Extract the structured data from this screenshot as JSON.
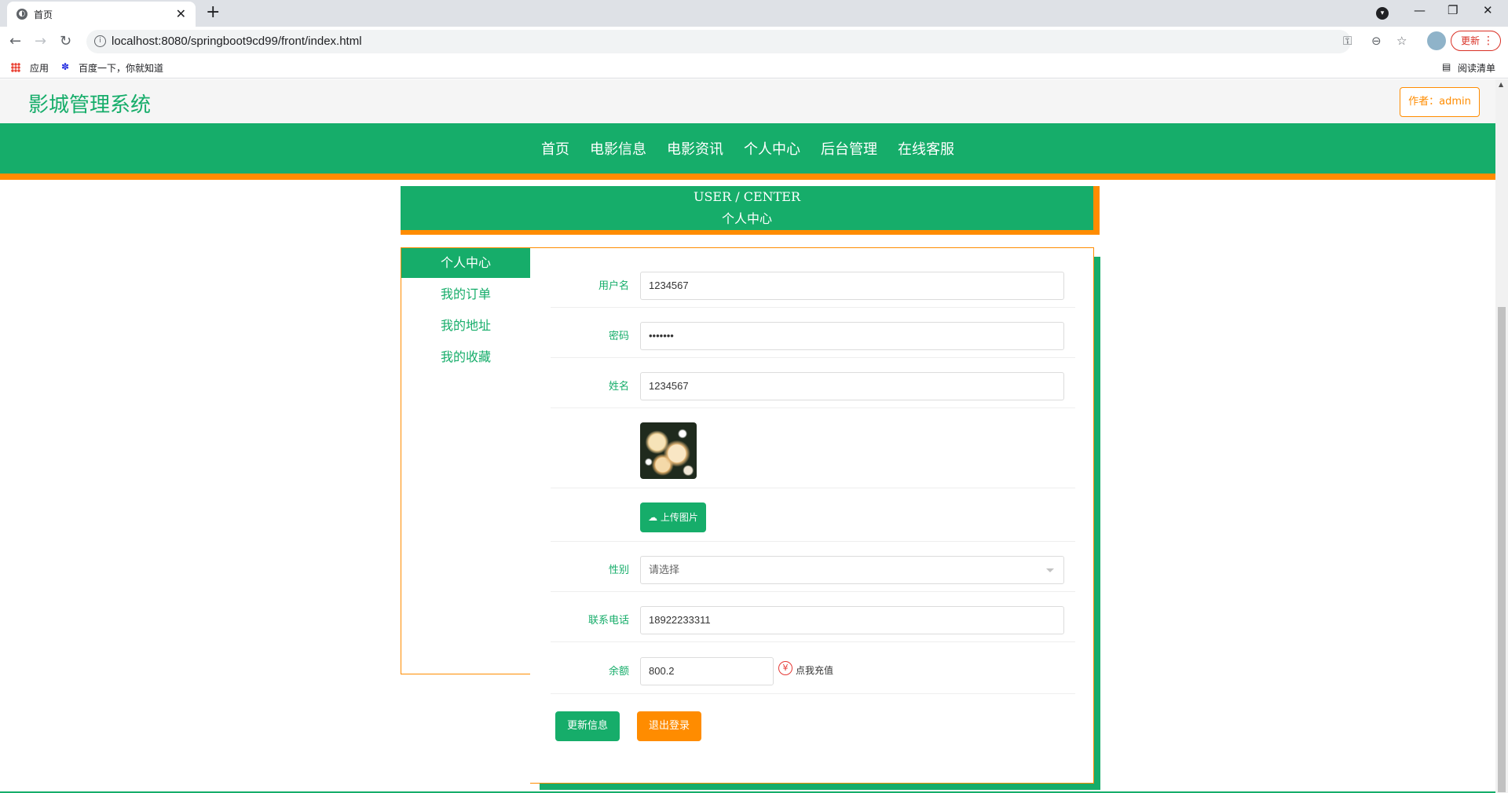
{
  "browser": {
    "tab_title": "首页",
    "tab_close": "✕",
    "new_tab": "+",
    "url": "localhost:8080/springboot9cd99/front/index.html",
    "update_label": "更新",
    "bookmarks": [
      {
        "label": "应用"
      },
      {
        "label": "百度一下，你就知道"
      }
    ],
    "reading_list": "阅读清单"
  },
  "site": {
    "title": "影城管理系统",
    "author_badge": "作者：admin"
  },
  "nav": {
    "items": [
      "首页",
      "电影信息",
      "电影资讯",
      "个人中心",
      "后台管理",
      "在线客服"
    ]
  },
  "banner": {
    "en": "USER / CENTER",
    "cn": "个人中心"
  },
  "side_menu": {
    "items": [
      {
        "label": "个人中心",
        "active": true
      },
      {
        "label": "我的订单",
        "active": false
      },
      {
        "label": "我的地址",
        "active": false
      },
      {
        "label": "我的收藏",
        "active": false
      }
    ]
  },
  "form": {
    "username": {
      "label": "用户名",
      "value": "1234567"
    },
    "password": {
      "label": "密码",
      "value": "•••••••"
    },
    "name": {
      "label": "姓名",
      "value": "1234567"
    },
    "upload_label": "上传图片",
    "gender": {
      "label": "性别",
      "placeholder": "请选择"
    },
    "phone": {
      "label": "联系电话",
      "value": "18922233311"
    },
    "balance": {
      "label": "余额",
      "value": "800.2",
      "recharge_icon": "¥",
      "recharge_label": "点我充值"
    },
    "update_button": "更新信息",
    "logout_button": "退出登录"
  },
  "colors": {
    "primary_green": "#16ad6a",
    "accent_orange": "#ff8c00"
  }
}
